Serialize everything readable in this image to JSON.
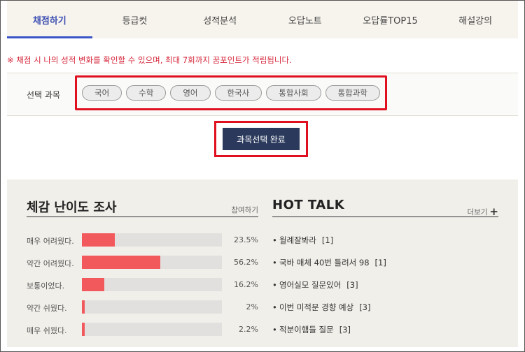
{
  "tabs": [
    {
      "label": "채점하기",
      "active": true
    },
    {
      "label": "등급컷",
      "active": false
    },
    {
      "label": "성적분석",
      "active": false
    },
    {
      "label": "오답노트",
      "active": false
    },
    {
      "label": "오답률TOP15",
      "active": false
    },
    {
      "label": "해설강의",
      "active": false
    }
  ],
  "notice": "※ 채점 시 나의 성적 변화를 확인할 수 있으며, 최대 7회까지 꿈포인트가 적립됩니다.",
  "subject": {
    "label": "선택 과목",
    "chips": [
      "국어",
      "수학",
      "영어",
      "한국사",
      "통합사회",
      "통합과학"
    ]
  },
  "complete_button": "과목선택 완료",
  "survey": {
    "title": "체감 난이도 조사",
    "link": "참여하기",
    "rows": [
      {
        "label": "매우 어려웠다.",
        "pct_text": "23.5%",
        "value": 23.5
      },
      {
        "label": "약간 어려웠다.",
        "pct_text": "56.2%",
        "value": 56.2
      },
      {
        "label": "보통이었다.",
        "pct_text": "16.2%",
        "value": 16.2
      },
      {
        "label": "약간 쉬웠다.",
        "pct_text": "2%",
        "value": 2
      },
      {
        "label": "매우 쉬웠다.",
        "pct_text": "2.2%",
        "value": 2.2
      }
    ]
  },
  "hot": {
    "title": "HOT TALK",
    "more": "더보기",
    "more_icon": "plus-icon",
    "items": [
      {
        "text": "월례잘봐라",
        "count": "[1]"
      },
      {
        "text": "국바 매체 40번 틀려서 98",
        "count": "[1]"
      },
      {
        "text": "영어실모 질문있어",
        "count": "[3]"
      },
      {
        "text": "이번 미적분 경향 예상",
        "count": "[3]"
      },
      {
        "text": "적분이햄들 질문",
        "count": "[3]"
      }
    ]
  },
  "colors": {
    "accent": "#3b55c8",
    "bar": "#f2595d",
    "highlight": "#e01020",
    "button": "#2b3a5c"
  }
}
